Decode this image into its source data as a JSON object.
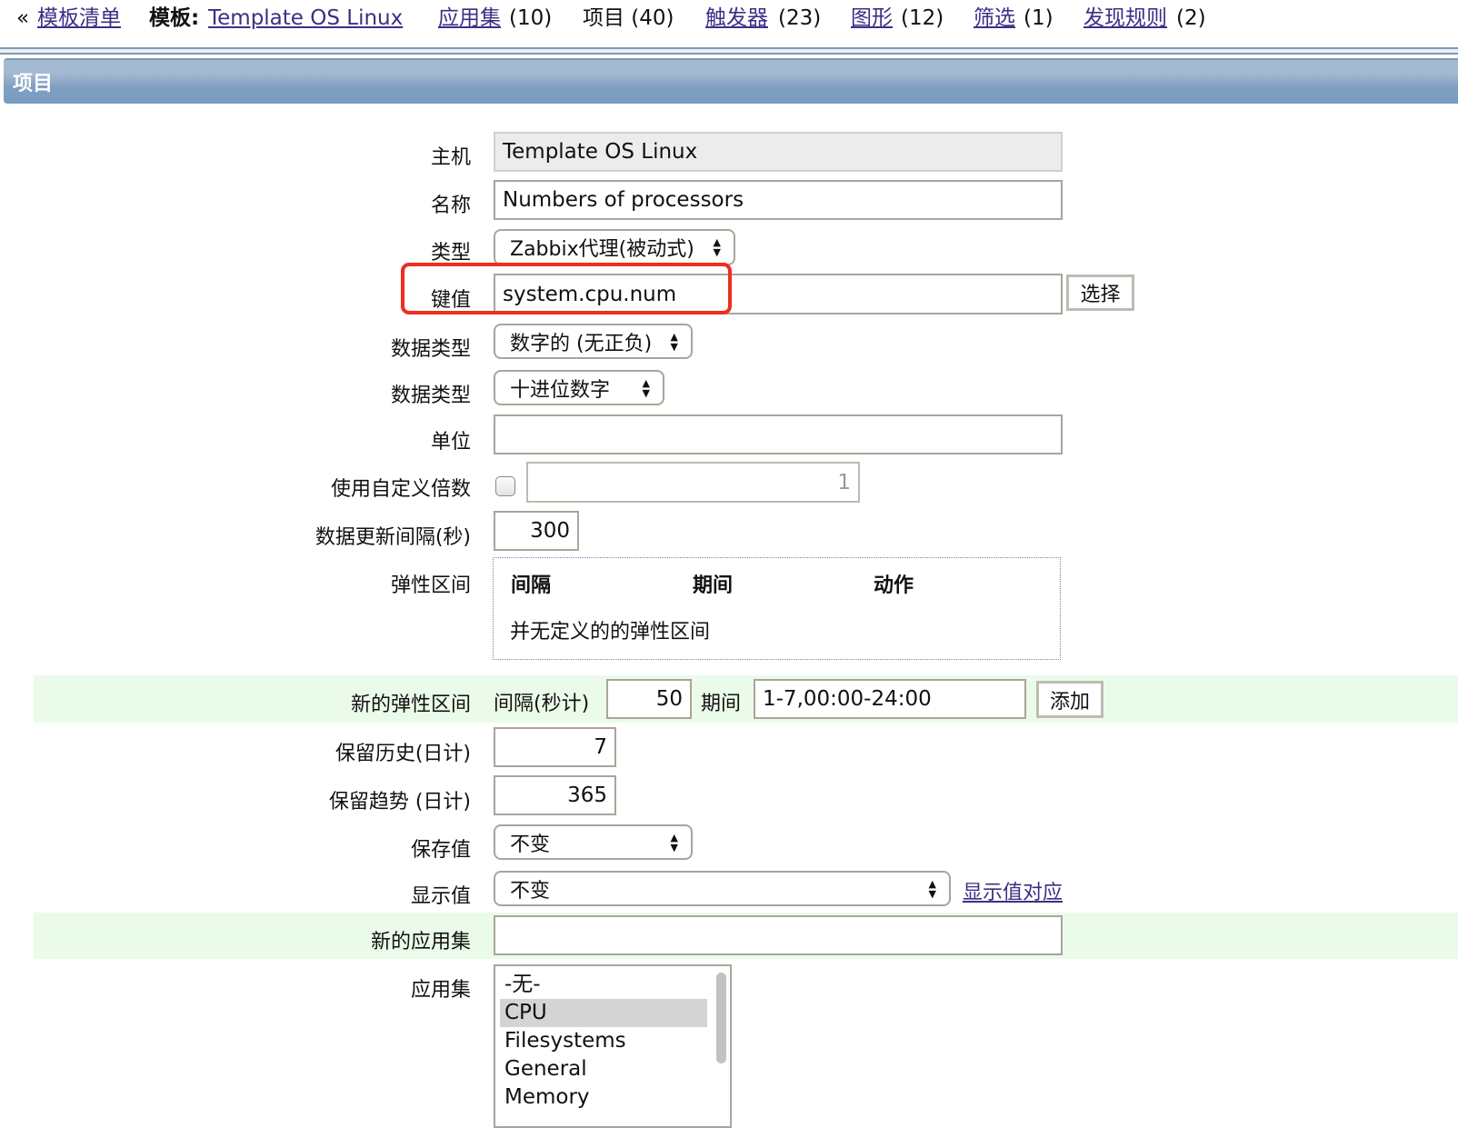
{
  "nav": {
    "back_symbol": "«",
    "template_list_link": "模板清单",
    "template_prefix": "模板:",
    "template_name_link": "Template OS Linux",
    "applications_link": "应用集",
    "applications_count": "(10)",
    "items_label": "项目 (40)",
    "triggers_link": "触发器",
    "triggers_count": "(23)",
    "graphs_link": "图形",
    "graphs_count": "(12)",
    "screens_link": "筛选",
    "screens_count": "(1)",
    "discovery_link": "发现规则",
    "discovery_count": "(2)"
  },
  "section": {
    "title": "项目"
  },
  "form": {
    "host": {
      "label": "主机",
      "value": "Template OS Linux"
    },
    "name": {
      "label": "名称",
      "value": "Numbers of processors"
    },
    "type": {
      "label": "类型",
      "value": "Zabbix代理(被动式)"
    },
    "key": {
      "label": "键值",
      "value": "system.cpu.num",
      "select_button": "选择"
    },
    "value_type": {
      "label": "数据类型",
      "value": "数字的 (无正负)"
    },
    "data_type": {
      "label": "数据类型",
      "value": "十进位数字"
    },
    "units": {
      "label": "单位",
      "value": ""
    },
    "multiplier": {
      "label": "使用自定义倍数",
      "checked": false,
      "value": "1"
    },
    "update_interval": {
      "label": "数据更新间隔(秒)",
      "value": "300"
    },
    "flexible_intervals": {
      "label": "弹性区间",
      "columns": [
        "间隔",
        "期间",
        "动作"
      ],
      "empty_text": "并无定义的的弹性区间"
    },
    "new_flexible_interval": {
      "label": "新的弹性区间",
      "interval_label": "间隔(秒计)",
      "interval_value": "50",
      "period_label": "期间",
      "period_value": "1-7,00:00-24:00",
      "add_button": "添加"
    },
    "history": {
      "label": "保留历史(日计)",
      "value": "7"
    },
    "trends": {
      "label": "保留趋势 (日计)",
      "value": "365"
    },
    "store_value": {
      "label": "保存值",
      "value": "不变"
    },
    "show_value": {
      "label": "显示值",
      "value": "不变",
      "mapping_link": "显示值对应"
    },
    "new_application": {
      "label": "新的应用集",
      "value": ""
    },
    "applications": {
      "label": "应用集",
      "options": [
        "-无-",
        "CPU",
        "Filesystems",
        "General",
        "Memory"
      ],
      "selected": "CPU"
    }
  },
  "colors": {
    "link": "#3c2f86",
    "header_gradient_top": "#a4bad2",
    "header_gradient_bottom": "#789dc0",
    "highlight_row": "#ebfbe9",
    "annotation_red": "#ee2d20"
  }
}
